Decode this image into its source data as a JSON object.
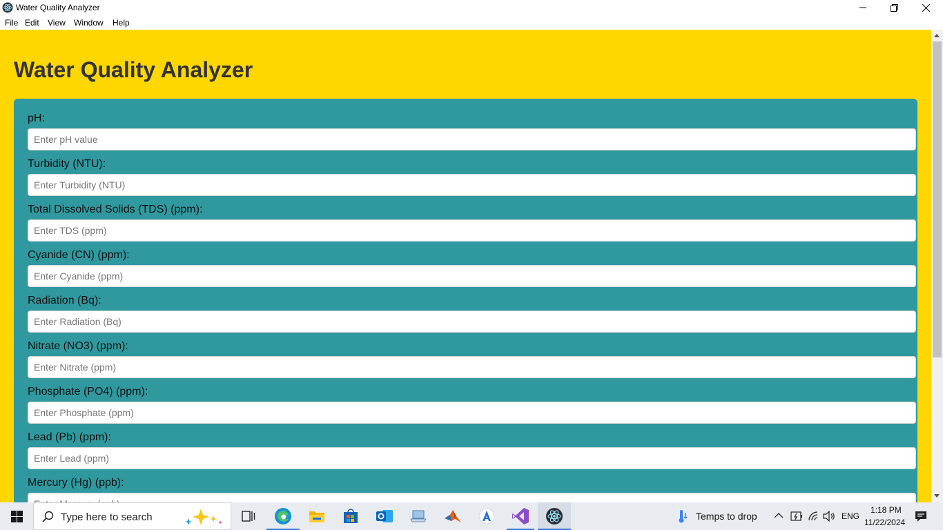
{
  "window": {
    "title": "Water Quality Analyzer",
    "controls": {
      "minimize": "minimize-icon",
      "restore": "restore-icon",
      "close": "close-icon"
    }
  },
  "menu": [
    "File",
    "Edit",
    "View",
    "Window",
    "Help"
  ],
  "app": {
    "heading": "Water Quality Analyzer",
    "fields": [
      {
        "label": "pH:",
        "placeholder": "Enter pH value"
      },
      {
        "label": "Turbidity (NTU):",
        "placeholder": "Enter Turbidity (NTU)"
      },
      {
        "label": "Total Dissolved Solids (TDS) (ppm):",
        "placeholder": "Enter TDS (ppm)"
      },
      {
        "label": "Cyanide (CN) (ppm):",
        "placeholder": "Enter Cyanide (ppm)"
      },
      {
        "label": "Radiation (Bq):",
        "placeholder": "Enter Radiation (Bq)"
      },
      {
        "label": "Nitrate (NO3) (ppm):",
        "placeholder": "Enter Nitrate (ppm)"
      },
      {
        "label": "Phosphate (PO4) (ppm):",
        "placeholder": "Enter Phosphate (ppm)"
      },
      {
        "label": "Lead (Pb) (ppm):",
        "placeholder": "Enter Lead (ppm)"
      },
      {
        "label": "Mercury (Hg) (ppb):",
        "placeholder": "Enter Mercury (ppb)"
      }
    ]
  },
  "colors": {
    "background": "#FFD700",
    "panel": "#30999F",
    "heading": "#333333"
  },
  "taskbar": {
    "search_placeholder": "Type here to search",
    "apps": [
      "task-view-icon",
      "edge-icon",
      "file-explorer-icon",
      "store-icon",
      "outlook-icon",
      "laptop-icon",
      "matlab-icon",
      "app-a-icon",
      "visual-studio-icon",
      "electron-icon"
    ],
    "weather": "Temps to drop",
    "language": "ENG",
    "time": "1:18 PM",
    "date": "11/22/2024"
  }
}
